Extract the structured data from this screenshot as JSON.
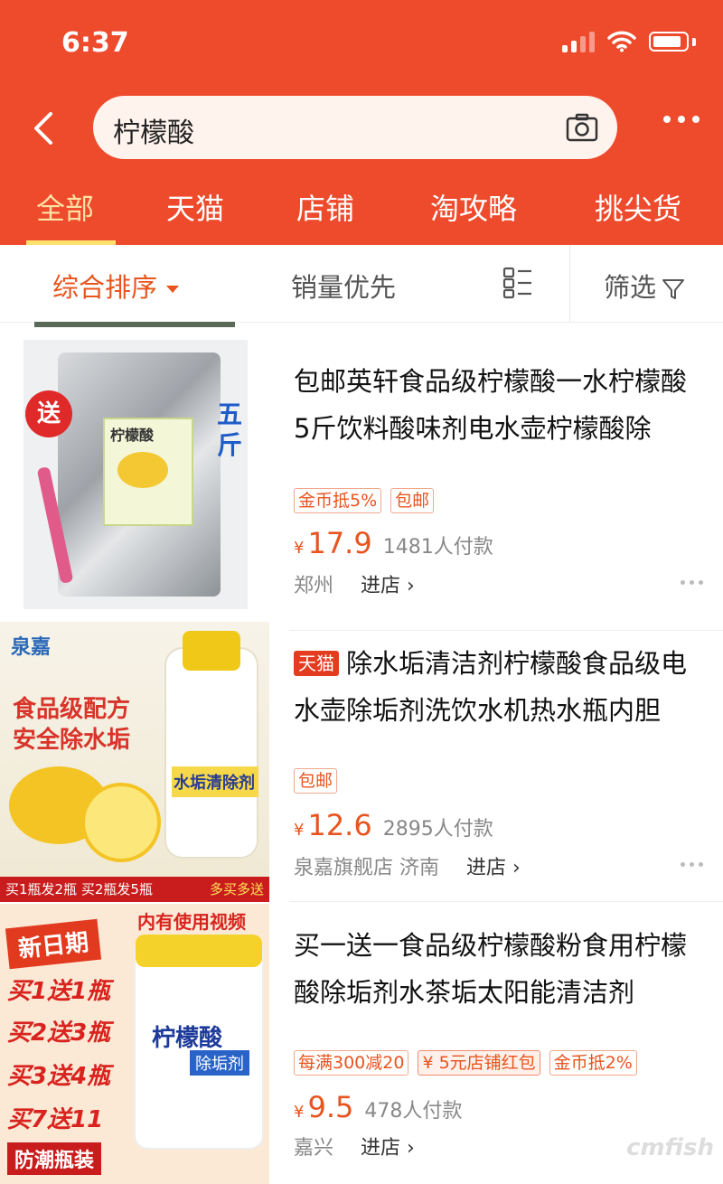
{
  "status": {
    "time": "6:37"
  },
  "search": {
    "query": "柠檬酸"
  },
  "tabs": [
    "全部",
    "天猫",
    "店铺",
    "淘攻略",
    "挑尖货"
  ],
  "sortbar": {
    "comprehensive": "综合排序",
    "sales": "销量优先",
    "filter": "筛选"
  },
  "items": [
    {
      "title": "包邮英轩食品级柠檬酸一水柠檬酸5斤饮料酸味剂电水壶柠檬酸除",
      "tags": [
        "金币抵5%",
        "包邮"
      ],
      "price": "17.9",
      "sold": "1481人付款",
      "location": "郑州",
      "shop": "",
      "go": "进店 ›",
      "thumb": {
        "badge": "送",
        "side": "五斤",
        "label": "柠檬酸"
      }
    },
    {
      "tmall": "天猫",
      "title": "除水垢清洁剂柠檬酸食品级电水壶除垢剂洗饮水机热水瓶内胆",
      "tags": [
        "包邮"
      ],
      "price": "12.6",
      "sold": "2895人付款",
      "shop": "泉嘉旗舰店",
      "location": "济南",
      "go": "进店 ›",
      "thumb": {
        "brand": "泉嘉",
        "line1": "食品级配方",
        "line2": "安全除水垢",
        "bottle": "水垢清除剂",
        "promo": "买1瓶发2瓶 买2瓶发5瓶",
        "promo2": "多买多送"
      }
    },
    {
      "title": "买一送一食品级柠檬酸粉食用柠檬酸除垢剂水茶垢太阳能清洁剂",
      "tags": [
        "每满300减20",
        "¥ 5元店铺红包",
        "金币抵2%"
      ],
      "price": "9.5",
      "sold": "478人付款",
      "location": "嘉兴",
      "shop": "",
      "go": "进店 ›",
      "thumb": {
        "new": "新日期",
        "video": "内有使用视频",
        "offers": [
          "买1送1瓶",
          "买2送3瓶",
          "买3送4瓶",
          "买7送11"
        ],
        "bottom": "防潮瓶装",
        "jar": "柠檬酸",
        "jar2": "除垢剂"
      }
    }
  ],
  "watermark": "cmfish",
  "colors": {
    "header": "#ee4a2c",
    "accent": "#e8541e",
    "tab_active": "#ffe2a4"
  }
}
